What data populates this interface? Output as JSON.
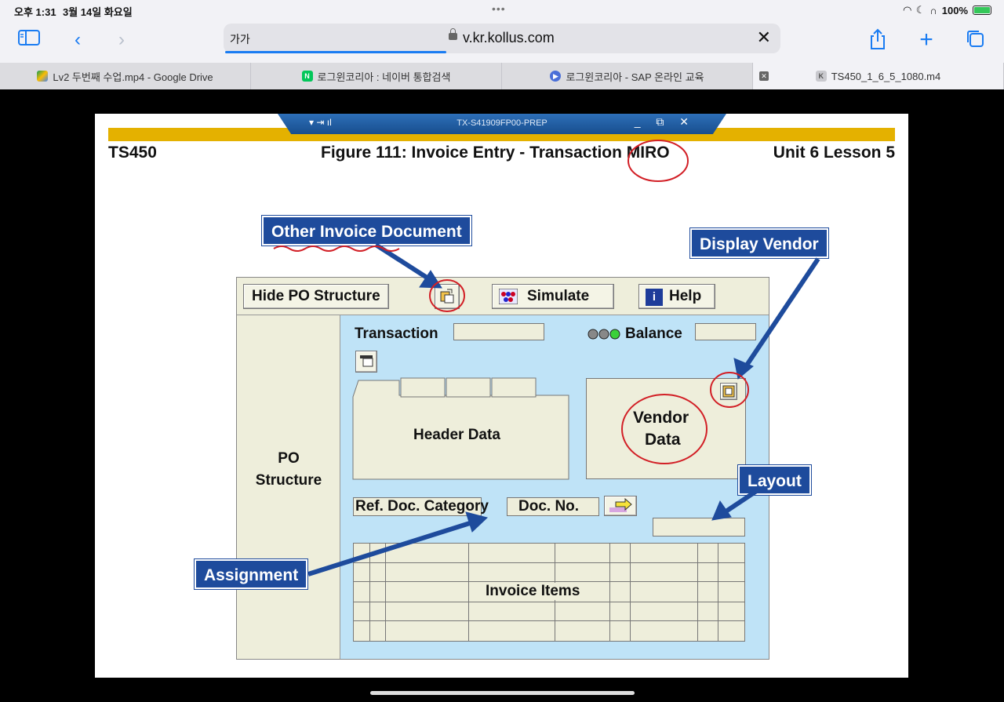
{
  "status": {
    "time": "오후 1:31",
    "date": "3월 14일 화요일",
    "battery": "100%"
  },
  "browser": {
    "text_size_label": "가가",
    "url": "v.kr.kollus.com",
    "tabs": [
      {
        "label": "Lv2 두번째 수업.mp4 - Google Drive"
      },
      {
        "label": "로그윈코리아 : 네이버 통합검색"
      },
      {
        "label": "로그윈코리아 - SAP 온라인 교육"
      },
      {
        "label": "TS450_1_6_5_1080.m4"
      }
    ]
  },
  "slide": {
    "sap_window_title": "TX-S41909FP00-PREP",
    "course": "TS450",
    "figure_title": "Figure 111: Invoice Entry - Transaction MIRO",
    "unit": "Unit 6 Lesson 5",
    "callouts": {
      "other_invoice": "Other Invoice Document",
      "display_vendor": "Display Vendor",
      "layout": "Layout",
      "assignment": "Assignment"
    },
    "screen": {
      "hide_po_button": "Hide PO Structure",
      "simulate_button": "Simulate",
      "help_button": "Help",
      "transaction_label": "Transaction",
      "balance_label": "Balance",
      "header_data": "Header Data",
      "vendor_data_line1": "Vendor",
      "vendor_data_line2": "Data",
      "po_structure_line1": "PO",
      "po_structure_line2": "Structure",
      "ref_doc_category": "Ref. Doc. Category",
      "doc_no": "Doc. No.",
      "invoice_items": "Invoice Items"
    }
  }
}
